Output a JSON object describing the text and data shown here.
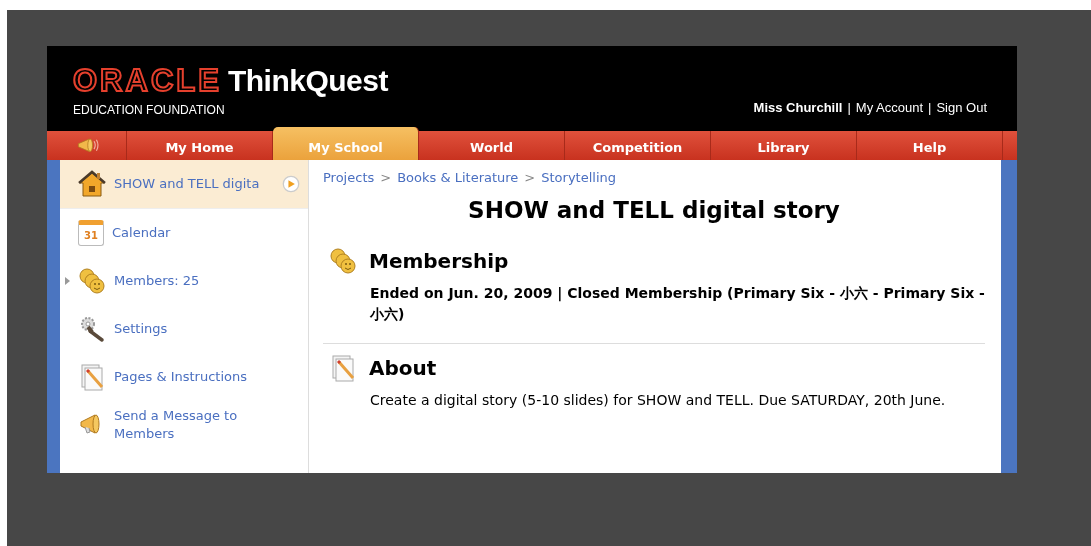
{
  "header": {
    "logo_brand": "ORACLE",
    "logo_product": "ThinkQuest",
    "logo_subtitle": "EDUCATION FOUNDATION",
    "user_links": [
      {
        "label": "Miss Churchill",
        "kind": "user"
      },
      {
        "label": "|",
        "kind": "sep"
      },
      {
        "label": "My Account",
        "kind": "link"
      },
      {
        "label": "|",
        "kind": "sep"
      },
      {
        "label": "Sign Out",
        "kind": "link"
      }
    ]
  },
  "nav": {
    "tabs": [
      {
        "label": "My Home",
        "selected": false
      },
      {
        "label": "My School",
        "selected": true
      },
      {
        "label": "World",
        "selected": false
      },
      {
        "label": "Competition",
        "selected": false
      },
      {
        "label": "Library",
        "selected": false
      },
      {
        "label": "Help",
        "selected": false
      }
    ]
  },
  "sidebar": {
    "items": [
      {
        "kind": "home",
        "label": "SHOW and TELL digita",
        "selected": true
      },
      {
        "kind": "calendar",
        "label": "Calendar",
        "icon_text": "31",
        "selected": false
      },
      {
        "kind": "members",
        "label": "Members: 25",
        "selected": false,
        "expanded": false
      },
      {
        "kind": "settings",
        "label": "Settings",
        "selected": false
      },
      {
        "kind": "pages",
        "label": "Pages & Instructions",
        "selected": false
      },
      {
        "kind": "message",
        "label": "Send a Message to Members",
        "selected": false
      }
    ]
  },
  "main": {
    "breadcrumb": [
      "Projects",
      "Books & Literature",
      "Storytelling"
    ],
    "breadcrumb_separator": ">",
    "title": "SHOW and TELL digital story",
    "sections": [
      {
        "kind": "members",
        "heading": "Membership",
        "text": "Ended on Jun. 20, 2009 | Closed Membership (Primary Six - 小六 - Primary Six - 小六)",
        "bold": true
      },
      {
        "kind": "pages",
        "heading": "About",
        "text": "Create a digital story (5-10 slides) for SHOW and TELL. Due SATURDAY, 20th June.",
        "bold": false
      }
    ]
  }
}
